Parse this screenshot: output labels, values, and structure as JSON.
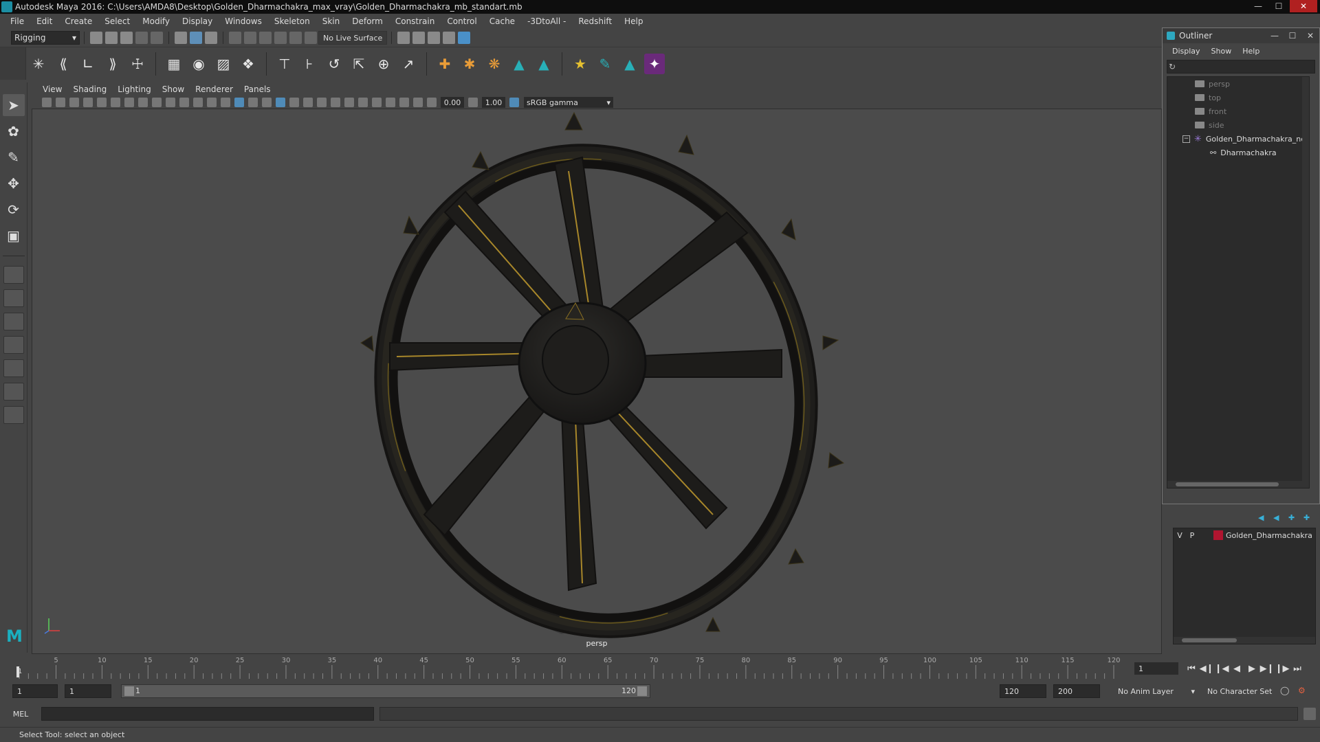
{
  "window": {
    "title": "Autodesk Maya 2016: C:\\Users\\AMDA8\\Desktop\\Golden_Dharmachakra_max_vray\\Golden_Dharmachakra_mb_standart.mb"
  },
  "menubar": {
    "items": [
      "File",
      "Edit",
      "Create",
      "Select",
      "Modify",
      "Display",
      "Windows",
      "Skeleton",
      "Skin",
      "Deform",
      "Constrain",
      "Control",
      "Cache",
      "-3DtoAll -",
      "Redshift",
      "Help"
    ]
  },
  "statusline": {
    "mode": "Rigging",
    "live_surface": "No Live Surface"
  },
  "panel": {
    "menu": [
      "View",
      "Shading",
      "Lighting",
      "Show",
      "Renderer",
      "Panels"
    ],
    "exposure": "0.00",
    "gamma_value": "1.00",
    "color_space": "sRGB gamma",
    "camera_label": "persp"
  },
  "outliner": {
    "title": "Outliner",
    "menu": [
      "Display",
      "Show",
      "Help"
    ],
    "cameras": [
      "persp",
      "top",
      "front",
      "side"
    ],
    "root_node": "Golden_Dharmachakra_ncl",
    "child_node": "Dharmachakra"
  },
  "layers": {
    "v": "V",
    "p": "P",
    "layer_name": "Golden_Dharmachakra",
    "layer_color": "#b01530"
  },
  "timeslider": {
    "ticks": [
      "5",
      "10",
      "15",
      "20",
      "25",
      "30",
      "35",
      "40",
      "45",
      "50",
      "55",
      "60",
      "65",
      "70",
      "75",
      "80",
      "85",
      "90",
      "95",
      "100",
      "105",
      "110",
      "115",
      "120"
    ],
    "current_frame_label": "1",
    "current_frame_field": "1"
  },
  "rangeslider": {
    "start_field": "1",
    "playback_start_field": "1",
    "range_start_label": "1",
    "range_end_label": "120",
    "playback_end_field": "120",
    "end_field": "200",
    "anim_layer": "No Anim Layer",
    "character_set": "No Character Set"
  },
  "cmdline": {
    "language": "MEL"
  },
  "helpline": {
    "text": "Select Tool: select an object"
  }
}
